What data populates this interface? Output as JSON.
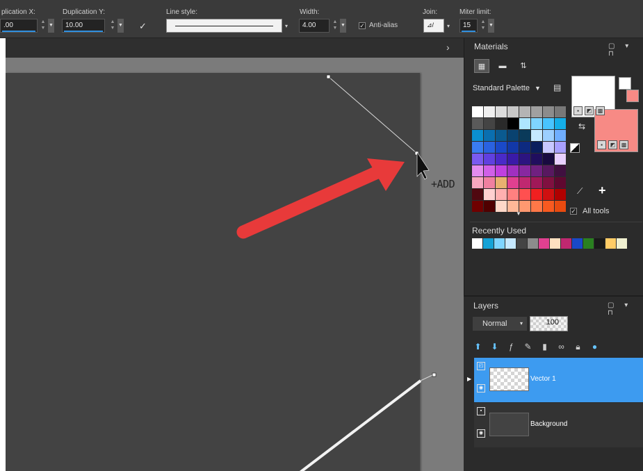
{
  "toolbar": {
    "dup_x_label": "plication X:",
    "dup_x_value": ".00",
    "dup_y_label": "Duplication Y:",
    "dup_y_value": "10.00",
    "apply_icon": "✓",
    "line_style_label": "Line style:",
    "width_label": "Width:",
    "width_value": "4.00",
    "antialias_label": "Anti-alias",
    "join_label": "Join:",
    "miter_label": "Miter limit:",
    "miter_value": "15"
  },
  "canvas": {
    "cursor_label": "+ADD",
    "tab_chevron": "›"
  },
  "materials": {
    "title": "Materials",
    "palette_name": "Standard Palette",
    "all_tools_label": "All tools",
    "recently_used_label": "Recently Used",
    "foreground_color": "#ffffff",
    "background_color": "#f78a85",
    "swatches": [
      "#ffffff",
      "#f0f0f0",
      "#dcdcdc",
      "#c8c8c8",
      "#b4b4b4",
      "#a0a0a0",
      "#8c8c8c",
      "#787878",
      "#5a5a5a",
      "#444444",
      "#2a2a2a",
      "#000000",
      "#aee6ff",
      "#7fd4ff",
      "#49c4ff",
      "#14aee8",
      "#0b8fd0",
      "#0a6fb0",
      "#0a5a90",
      "#094270",
      "#0a3a5a",
      "#c6e8ff",
      "#9ccfff",
      "#6faeff",
      "#3a7cf0",
      "#2a62e0",
      "#1a49c8",
      "#1238a8",
      "#0d2a80",
      "#0a1e5e",
      "#c8c8ff",
      "#a8a0ff",
      "#7a5af0",
      "#6040e0",
      "#4a2ac8",
      "#3a1aa8",
      "#2c1480",
      "#200e5e",
      "#180a40",
      "#e8d0ff",
      "#e48cf0",
      "#d060e8",
      "#c040e0",
      "#a030c0",
      "#8828a0",
      "#702080",
      "#581860",
      "#401040",
      "#f8a8c0",
      "#f080a0",
      "#e8b070",
      "#e04090",
      "#c02870",
      "#a01858",
      "#801040",
      "#600830",
      "#500810",
      "#ffd0d0",
      "#ffb0b0",
      "#ff8080",
      "#ff5050",
      "#f02020",
      "#d01010",
      "#b00000",
      "#700000",
      "#500000",
      "#ffd8c8",
      "#ffb898",
      "#ff9870",
      "#ff7848",
      "#f85a20",
      "#e84a10"
    ],
    "recent_colors": [
      "#ffffff",
      "#14a2d6",
      "#7fd4ff",
      "#c6e8ff",
      "#444444",
      "#8c8c8c",
      "#e04090",
      "#ffe0c0",
      "#c02870",
      "#1a49c8",
      "#2a8020",
      "#1a1a1a",
      "#ffcc66",
      "#f0f0d0"
    ]
  },
  "layers": {
    "title": "Layers",
    "blend_mode": "Normal",
    "opacity": "100",
    "items": [
      {
        "name": "Vector 1",
        "selected": true
      },
      {
        "name": "Background",
        "selected": false
      }
    ]
  },
  "icons": {
    "panel_menu": "▢ ▾ ⊓",
    "dropdown": "▾"
  }
}
